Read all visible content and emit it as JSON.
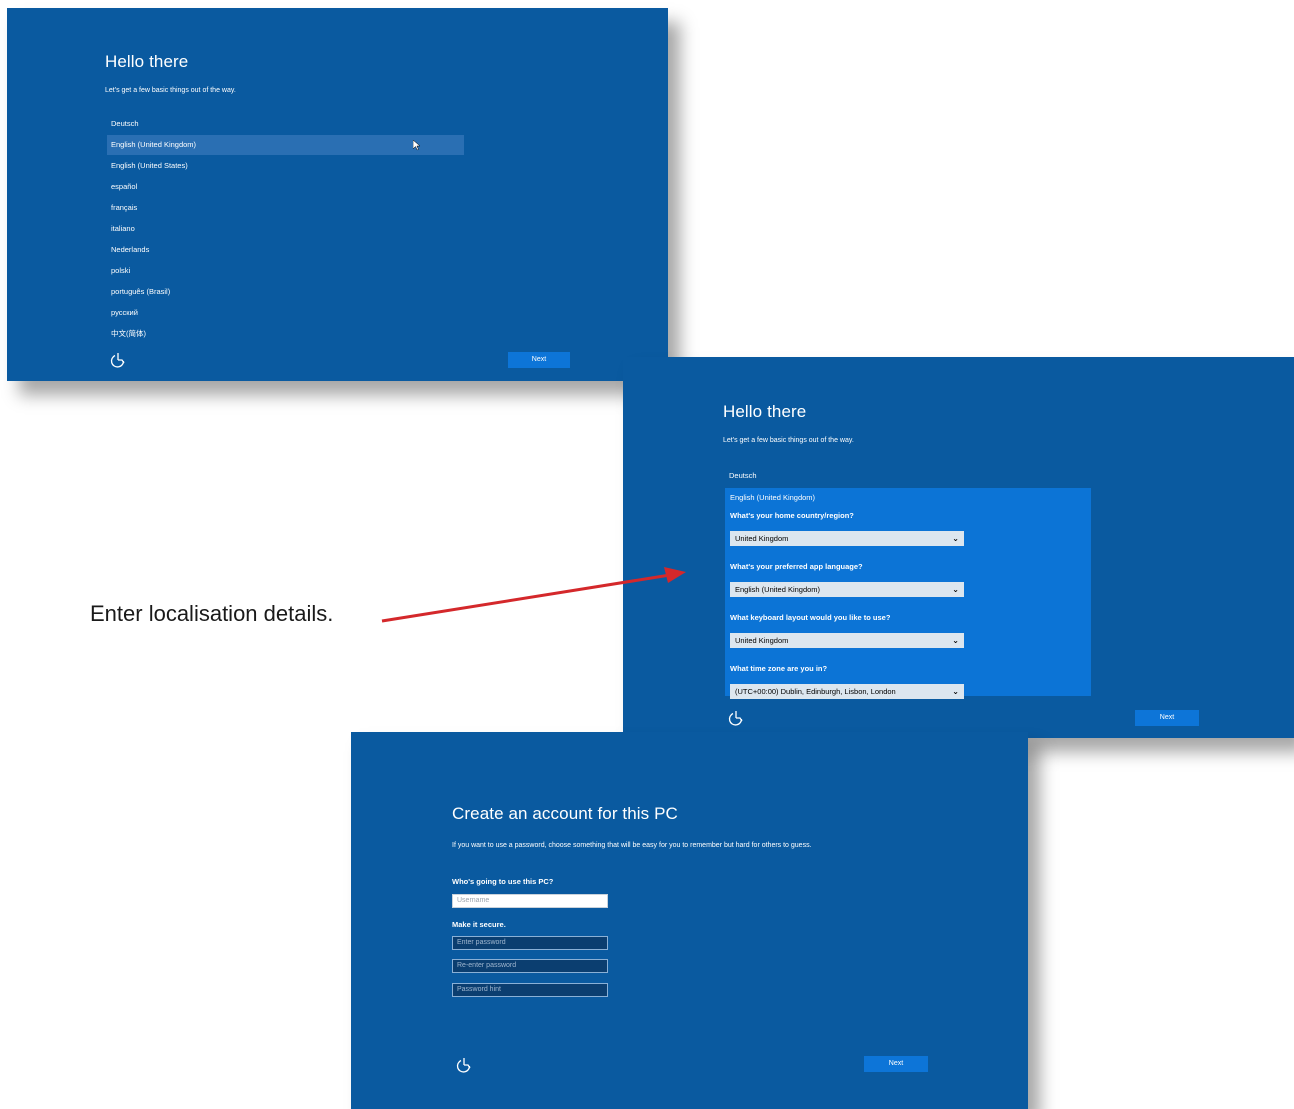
{
  "screen1": {
    "title": "Hello there",
    "subtitle": "Let's get a few basic things out of the way.",
    "languages": [
      "Deutsch",
      "English (United Kingdom)",
      "English (United States)",
      "español",
      "français",
      "italiano",
      "Nederlands",
      "polski",
      "português (Brasil)",
      "русский",
      "中文(简体)"
    ],
    "selected_language": "English (United Kingdom)",
    "next_label": "Next",
    "power_icon": "accessibility-icon"
  },
  "screen2": {
    "title": "Hello there",
    "subtitle": "Let's get a few basic things out of the way.",
    "language_above": "Deutsch",
    "selected_language": "English (United Kingdom)",
    "questions": [
      {
        "label": "What's your home country/region?",
        "value": "United Kingdom"
      },
      {
        "label": "What's your preferred app language?",
        "value": "English (United Kingdom)"
      },
      {
        "label": "What keyboard layout would you like to use?",
        "value": "United Kingdom"
      },
      {
        "label": "What time zone are you in?",
        "value": "(UTC+00:00) Dublin, Edinburgh, Lisbon, London"
      }
    ],
    "next_label": "Next"
  },
  "screen3": {
    "title": "Create an account for this PC",
    "description": "If you want to use a password, choose something that will be easy for you to remember but hard for others to guess.",
    "who_label": "Who's going to use this PC?",
    "username_placeholder": "Username",
    "secure_label": "Make it secure.",
    "password_placeholder": "Enter password",
    "reenter_placeholder": "Re-enter password",
    "hint_placeholder": "Password hint",
    "next_label": "Next"
  },
  "annotation": {
    "text": "Enter localisation details.",
    "arrow_color": "#d4282b"
  },
  "colors": {
    "background": "#0a5aa0",
    "panel": "#0c74d6",
    "button": "#0d75d8"
  }
}
